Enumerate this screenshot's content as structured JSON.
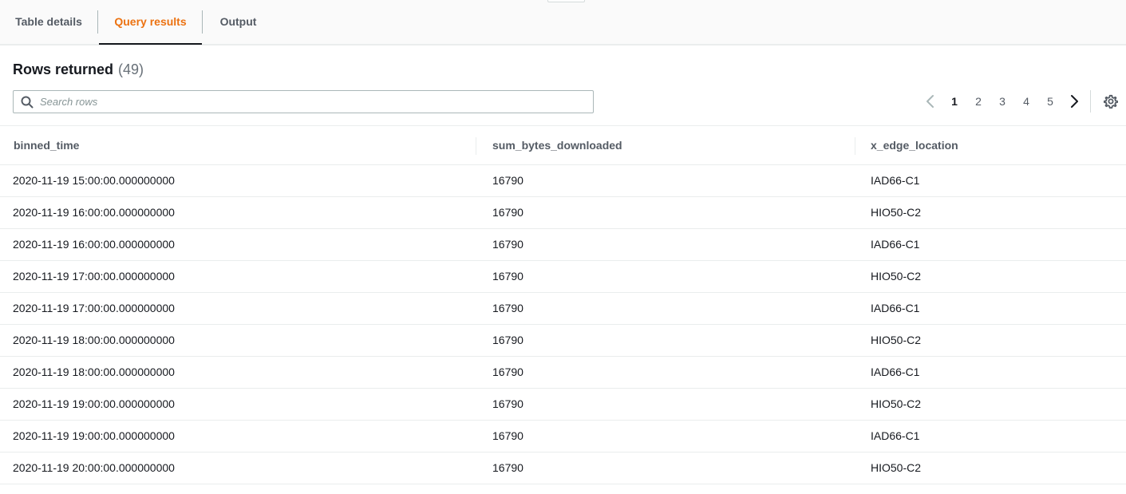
{
  "tabs": [
    {
      "label": "Table details",
      "active": false
    },
    {
      "label": "Query results",
      "active": true
    },
    {
      "label": "Output",
      "active": false
    }
  ],
  "results": {
    "title": "Rows returned",
    "count": "(49)",
    "search_placeholder": "Search rows",
    "search_value": ""
  },
  "pagination": {
    "pages": [
      "1",
      "2",
      "3",
      "4",
      "5"
    ],
    "current": "1",
    "prev_icon": "chevron-left-icon",
    "next_icon": "chevron-right-icon",
    "settings_icon": "gear-icon"
  },
  "table": {
    "columns": [
      "binned_time",
      "sum_bytes_downloaded",
      "x_edge_location"
    ],
    "rows": [
      [
        "2020-11-19 15:00:00.000000000",
        "16790",
        "IAD66-C1"
      ],
      [
        "2020-11-19 16:00:00.000000000",
        "16790",
        "HIO50-C2"
      ],
      [
        "2020-11-19 16:00:00.000000000",
        "16790",
        "IAD66-C1"
      ],
      [
        "2020-11-19 17:00:00.000000000",
        "16790",
        "HIO50-C2"
      ],
      [
        "2020-11-19 17:00:00.000000000",
        "16790",
        "IAD66-C1"
      ],
      [
        "2020-11-19 18:00:00.000000000",
        "16790",
        "HIO50-C2"
      ],
      [
        "2020-11-19 18:00:00.000000000",
        "16790",
        "IAD66-C1"
      ],
      [
        "2020-11-19 19:00:00.000000000",
        "16790",
        "HIO50-C2"
      ],
      [
        "2020-11-19 19:00:00.000000000",
        "16790",
        "IAD66-C1"
      ],
      [
        "2020-11-19 20:00:00.000000000",
        "16790",
        "HIO50-C2"
      ]
    ]
  },
  "colors": {
    "accent": "#ec7211",
    "text": "#16191f",
    "muted": "#545b64",
    "border": "#eaeded"
  }
}
